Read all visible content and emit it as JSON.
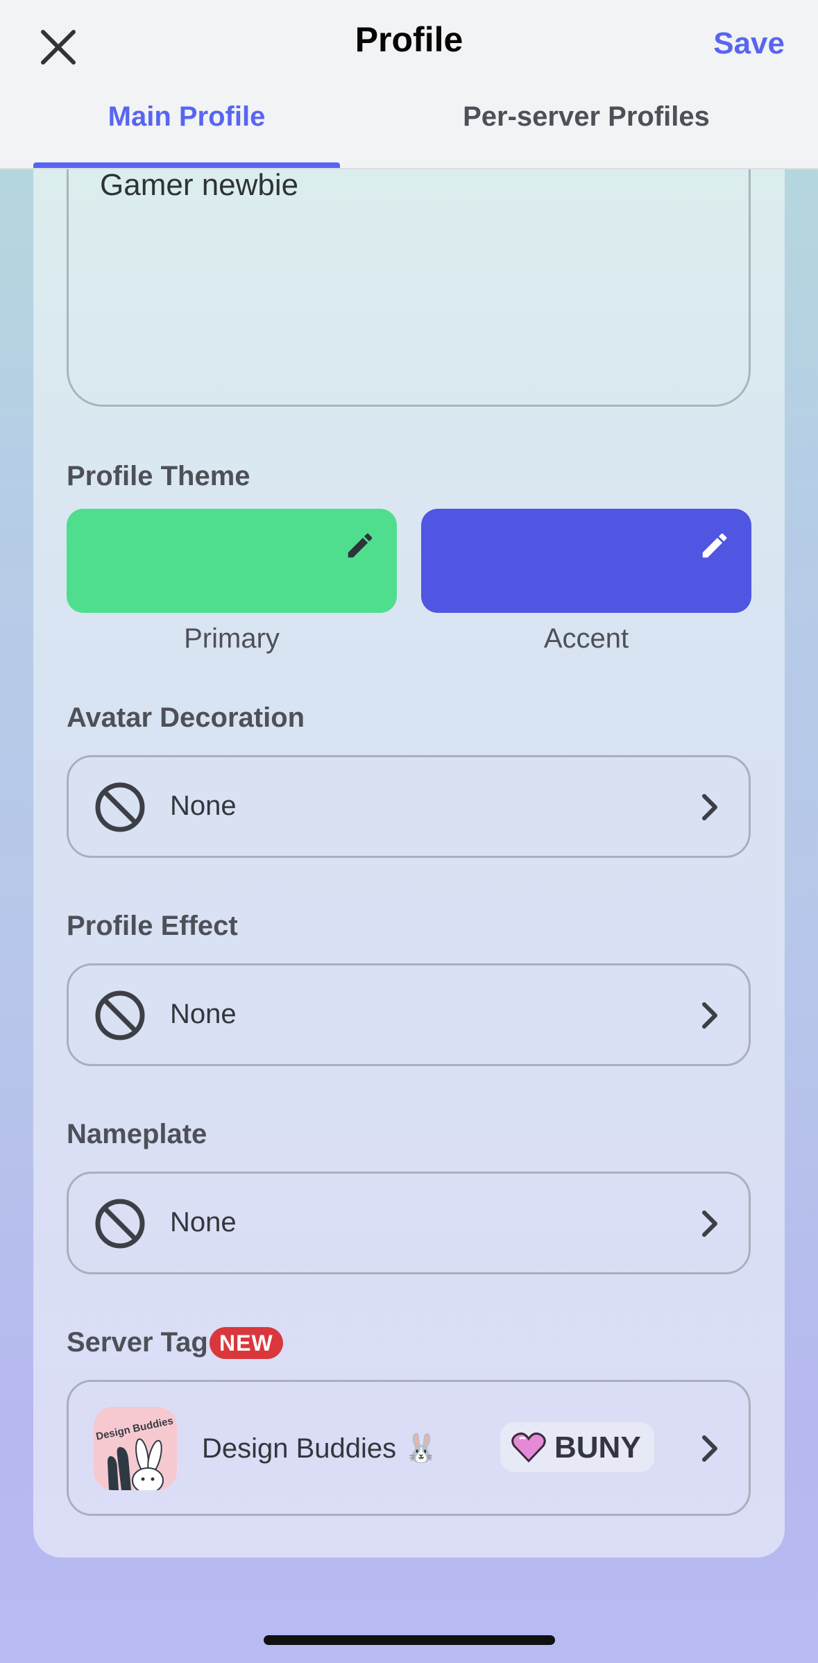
{
  "header": {
    "title": "Profile",
    "save_label": "Save",
    "close_icon": "close-icon",
    "tabs": [
      {
        "label": "Main Profile",
        "active": true
      },
      {
        "label": "Per-server Profiles",
        "active": false
      }
    ]
  },
  "bio": {
    "value": "Gamer newbie"
  },
  "profile_theme": {
    "label": "Profile Theme",
    "primary": {
      "caption": "Primary",
      "color": "#4fde8e"
    },
    "accent": {
      "caption": "Accent",
      "color": "#5055e2"
    }
  },
  "avatar_decoration": {
    "label": "Avatar Decoration",
    "value": "None"
  },
  "profile_effect": {
    "label": "Profile Effect",
    "value": "None"
  },
  "nameplate": {
    "label": "Nameplate",
    "value": "None"
  },
  "server_tag": {
    "label": "Server Tag",
    "badge": "NEW",
    "server_name": "Design Buddies 🐰",
    "logo_text": "Design Buddies",
    "tag": "BUNY"
  },
  "colors": {
    "brand": "#5865f2",
    "badge_red": "#da373c"
  }
}
